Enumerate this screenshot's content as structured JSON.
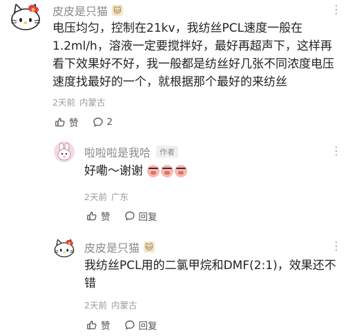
{
  "comments": [
    {
      "author": "皮皮是只猫",
      "badge": "🐱",
      "text_lines": [
        "电压均匀，控制在21kv，我纺丝PCL速度一般在",
        "1.2ml/h，溶液一定要搅拌好，最好再超声下，这样再",
        "看下效果好不好，我一般都是纺丝好几张不同浓度电压",
        "速度找最好的一个，就根据那个最好的来纺丝"
      ],
      "time": "2天前",
      "location": "内蒙古",
      "like_label": "赞",
      "reply_label": "2",
      "more": "⋮"
    },
    {
      "author": "啦啦啦是我哈",
      "author_tag": "作者",
      "text": "好嘞～谢谢",
      "time": "2天前",
      "location": "广东",
      "like_label": "赞",
      "reply_label": "回复",
      "more": "⋮"
    },
    {
      "author": "皮皮是只猫",
      "badge": "🐱",
      "text_lines": [
        "我纺丝PCL用的二氯甲烷和DMF(2:1)，效果还不",
        "错"
      ],
      "time": "2天前",
      "location": "内蒙古",
      "like_label": "赞",
      "reply_label": "回复",
      "more": "⋮"
    }
  ]
}
